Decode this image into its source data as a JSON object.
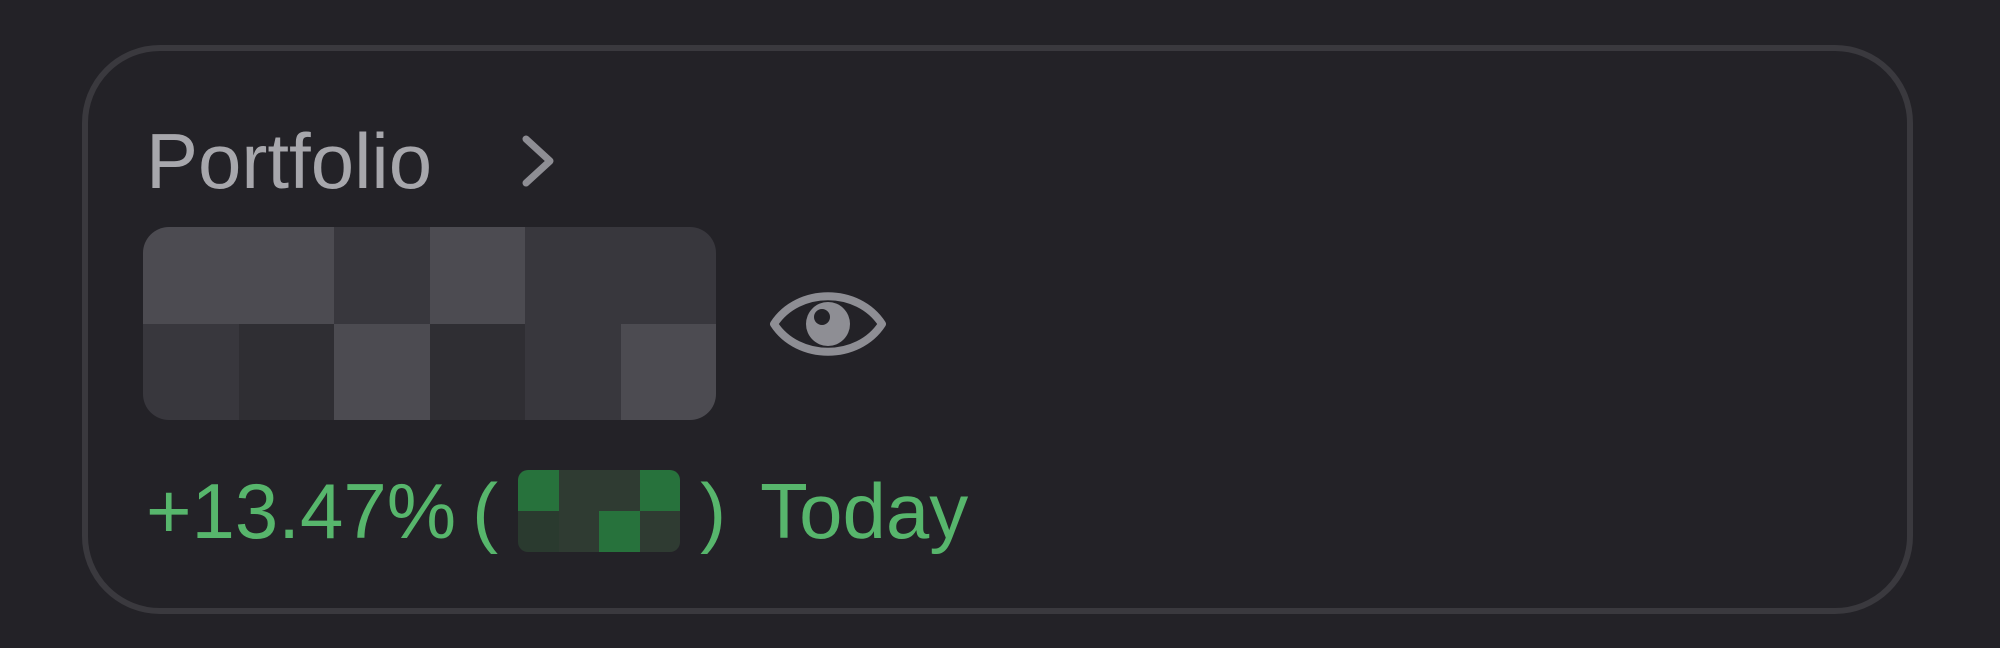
{
  "portfolio": {
    "title": "Portfolio",
    "chevron_icon": "chevron-right-icon",
    "value_visibility_icon": "eye-icon",
    "change_percent": "+13.47%",
    "change_open_paren": "(",
    "change_close_paren": ")",
    "change_period": "Today"
  },
  "colors": {
    "background": "#232227",
    "card_border": "#3a393e",
    "title_text": "#a7a7ac",
    "icon": "#8e8e94",
    "positive_change": "#57b66c"
  },
  "masked_value_blocks": [
    "#4c4b51",
    "#4c4b51",
    "#38373d",
    "#4c4b51",
    "#38373d",
    "#38373d",
    "#38373d",
    "#2f2e33",
    "#4c4b51",
    "#2f2e33",
    "#38373d",
    "#4c4b51"
  ],
  "masked_change_blocks": [
    "#27723c",
    "#2f3b32",
    "#2f3b32",
    "#27723c",
    "#2a3a2f",
    "#2f3b32",
    "#27723c",
    "#2f3b32"
  ]
}
